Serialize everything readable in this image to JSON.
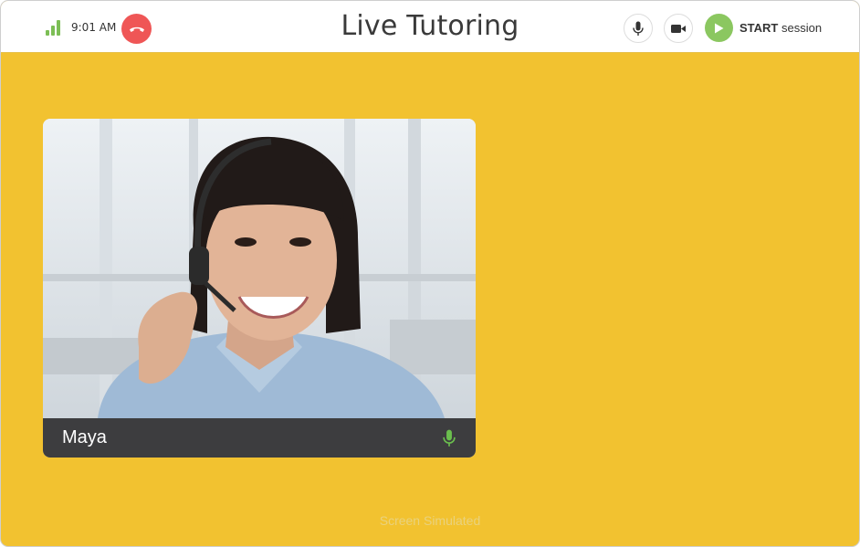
{
  "status": {
    "time": "9:01 AM"
  },
  "header": {
    "title": "Live Tutoring",
    "start_bold": "START",
    "start_rest": " session"
  },
  "participant": {
    "name": "Maya"
  },
  "footer": {
    "note": "Screen Simulated"
  },
  "colors": {
    "background": "#f2c230",
    "end_call": "#ef5656",
    "start": "#8bc760",
    "signal": "#7cbe55",
    "name_bar": "#3d3d3f",
    "mic_active": "#6bbf4e"
  },
  "icons": {
    "signal": "signal-bars-icon",
    "end_call": "phone-hangup-icon",
    "mic": "microphone-icon",
    "camera": "video-camera-icon",
    "play": "play-icon",
    "participant_mic": "microphone-icon"
  }
}
